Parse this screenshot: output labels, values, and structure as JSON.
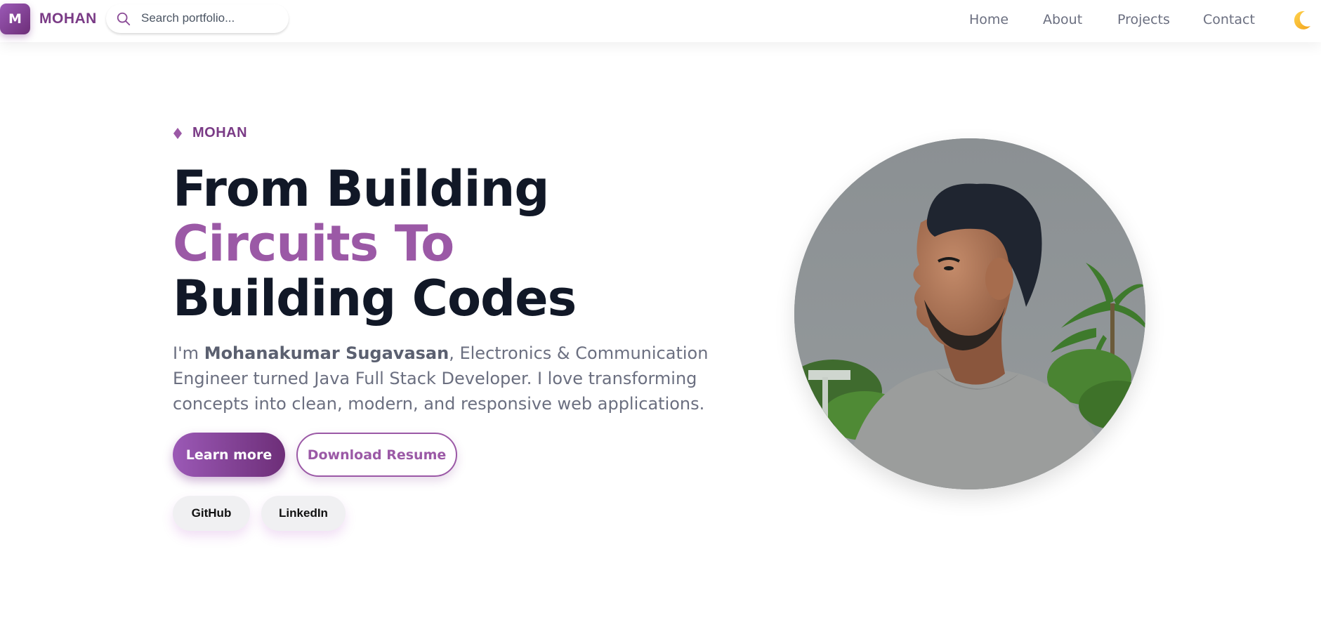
{
  "navbar": {
    "logo_letter": "M",
    "brand": "MOHAN",
    "search": {
      "placeholder": "Search portfolio...",
      "value": ""
    },
    "links": [
      {
        "label": "Home"
      },
      {
        "label": "About"
      },
      {
        "label": "Projects"
      },
      {
        "label": "Contact"
      }
    ],
    "theme_toggle_icon": "crescent-moon-icon"
  },
  "hero": {
    "eyebrow_icon": "diamond-icon",
    "eyebrow": "MOHAN",
    "headline": {
      "line1": "From Building",
      "line2": "Circuits To",
      "line3": "Building Codes"
    },
    "intro": {
      "prefix": "I'm ",
      "name": "Mohanakumar Sugavasan",
      "suffix": ", Electronics & Communication Engineer turned Java Full Stack Developer. I love transforming concepts into clean, modern, and responsive web applications."
    },
    "buttons": {
      "primary": "Learn more",
      "secondary": "Download Resume"
    },
    "social": [
      {
        "label": "GitHub"
      },
      {
        "label": "LinkedIn"
      }
    ]
  },
  "colors": {
    "accent": "#9b59a6",
    "accent_dark": "#6d2e78",
    "heading": "#111827",
    "body_text": "#6b6f80"
  }
}
